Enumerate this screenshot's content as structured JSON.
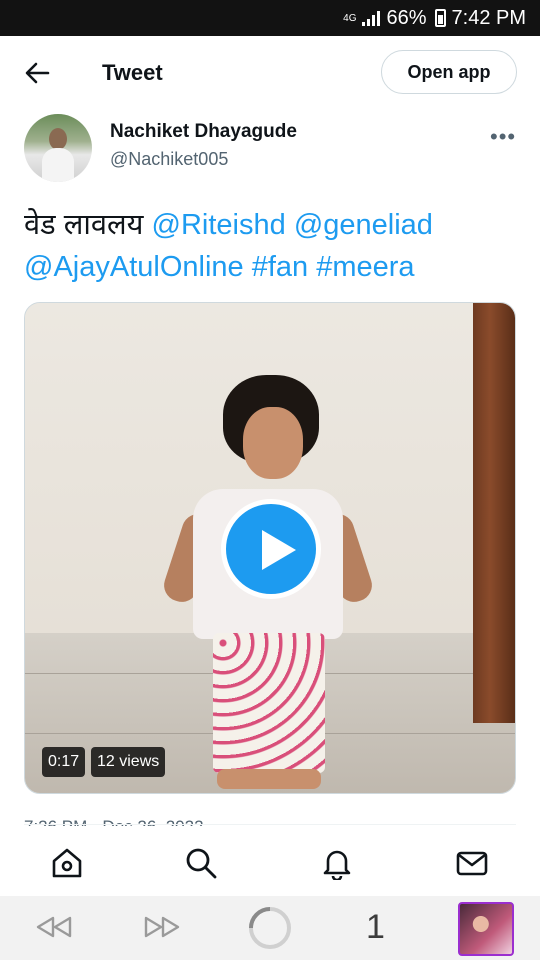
{
  "status_bar": {
    "network": "4G",
    "battery": "66%",
    "time": "7:42 PM"
  },
  "header": {
    "title": "Tweet",
    "open_app_label": "Open app"
  },
  "author": {
    "name": "Nachiket Dhayagude",
    "handle": "@Nachiket005"
  },
  "tweet": {
    "text_plain": "वेड लावलय",
    "mentions": [
      "@Riteishd",
      "@geneliad",
      "@AjayAtulOnline"
    ],
    "hashtags": [
      "#fan",
      "#meera"
    ],
    "timestamp": "7:26 PM · Dec 26, 2022"
  },
  "video": {
    "duration": "0:17",
    "views": "12 views"
  },
  "bottom_nav": {
    "icons": [
      "home-icon",
      "search-icon",
      "notifications-icon",
      "messages-icon"
    ]
  },
  "browser_bar": {
    "tab_count": "1"
  },
  "colors": {
    "accent": "#1d9bf0",
    "text": "#0f1419",
    "muted": "#536471"
  }
}
